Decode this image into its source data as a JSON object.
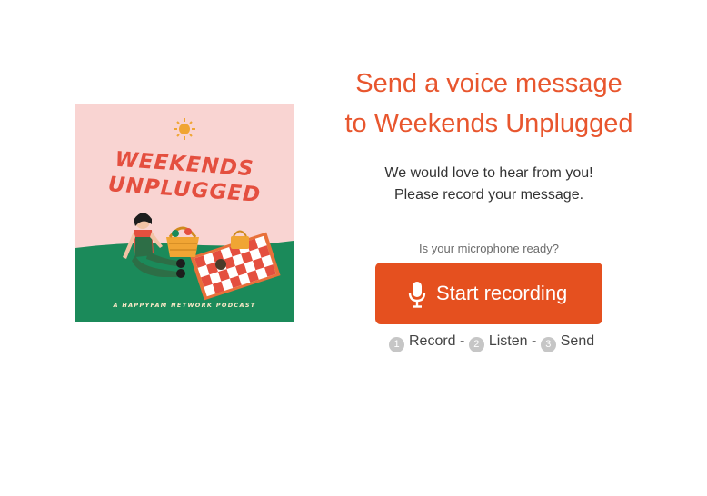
{
  "cover": {
    "title_line1": "WEEKENDS",
    "title_line2": "UNPLUGGED",
    "tagline": "A HAPPYFAM NETWORK PODCAST",
    "colors": {
      "background": "#f9d4d2",
      "grass": "#1b8a5a",
      "title": "#e44f3f"
    }
  },
  "heading": {
    "line1": "Send a voice message",
    "line2": "to Weekends Unplugged"
  },
  "intro": {
    "line1": "We would love to hear from you!",
    "line2": "Please record your message."
  },
  "mic_ready": "Is your microphone ready?",
  "record_button": {
    "label": "Start recording",
    "icon": "microphone-icon",
    "color": "#e5501f"
  },
  "steps": [
    {
      "number": "1",
      "label": "Record",
      "separator": "-"
    },
    {
      "number": "2",
      "label": "Listen",
      "separator": "-"
    },
    {
      "number": "3",
      "label": "Send"
    }
  ]
}
